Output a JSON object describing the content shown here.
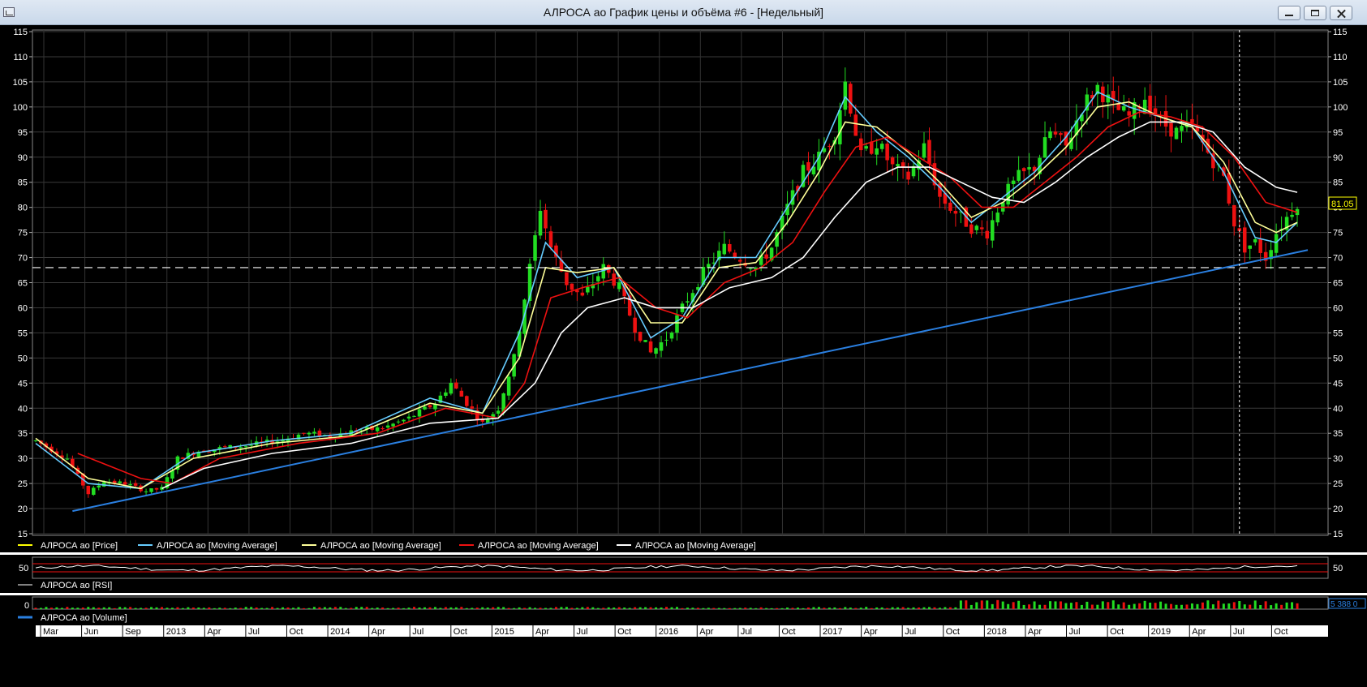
{
  "window": {
    "title": "АЛРОСА ао График цены и объёма #6 - [Недельный]"
  },
  "legend": {
    "price": "АЛРОСА ао [Price]",
    "ma1": "АЛРОСА ао [Moving Average]",
    "ma2": "АЛРОСА ао [Moving Average]",
    "ma3": "АЛРОСА ао [Moving Average]",
    "ma4": "АЛРОСА ао [Moving Average]",
    "rsi": "АЛРОСА ао [RSI]",
    "volume": "АЛРОСА ао [Volume]"
  },
  "colors": {
    "background": "#000000",
    "up_candle": "#22dd22",
    "down_candle": "#ee1111",
    "price": "#ffff00",
    "ma_fast": "#66ccff",
    "ma_mid": "#ffff99",
    "ma_red": "#ee1111",
    "ma_white": "#ffffff",
    "trendline": "#2a7fe0",
    "rsi_line": "#ffffff",
    "volume_bar": "#22dd22"
  },
  "price_labels": {
    "last": "81.05",
    "volume_last": "5 388 0"
  },
  "rsi_panel": {
    "level": "50"
  },
  "volume_panel": {
    "level": "0"
  },
  "chart_data": {
    "type": "candlestick",
    "timeframe": "weekly",
    "ylim": [
      15,
      115
    ],
    "yticks": [
      15,
      20,
      25,
      30,
      35,
      40,
      45,
      50,
      55,
      60,
      65,
      70,
      75,
      80,
      85,
      90,
      95,
      100,
      105,
      110,
      115
    ],
    "time_labels": [
      "Mar",
      "Jun",
      "Sep",
      "2013",
      "Apr",
      "Jul",
      "Oct",
      "2014",
      "Apr",
      "Jul",
      "Oct",
      "2015",
      "Apr",
      "Jul",
      "Oct",
      "2016",
      "Apr",
      "Jul",
      "Oct",
      "2017",
      "Apr",
      "Jul",
      "Oct",
      "2018",
      "Apr",
      "Jul",
      "Oct",
      "2019",
      "Apr",
      "Jul",
      "Oct"
    ],
    "close_series": [
      [
        0,
        33.5
      ],
      [
        6,
        30
      ],
      [
        10,
        23
      ],
      [
        13,
        25.5
      ],
      [
        17,
        25
      ],
      [
        21,
        23.5
      ],
      [
        24,
        24
      ],
      [
        27,
        30
      ],
      [
        31,
        31.5
      ],
      [
        35,
        32
      ],
      [
        40,
        32.5
      ],
      [
        46,
        33.5
      ],
      [
        51,
        35
      ],
      [
        56,
        34.5
      ],
      [
        61,
        35.5
      ],
      [
        66,
        36
      ],
      [
        71,
        38
      ],
      [
        76,
        41
      ],
      [
        79,
        45
      ],
      [
        82,
        41
      ],
      [
        85,
        37
      ],
      [
        88,
        40
      ],
      [
        91,
        50
      ],
      [
        94,
        68
      ],
      [
        96,
        80
      ],
      [
        98,
        72
      ],
      [
        101,
        65
      ],
      [
        104,
        62
      ],
      [
        108,
        68
      ],
      [
        111,
        64
      ],
      [
        114,
        56
      ],
      [
        117,
        51
      ],
      [
        120,
        54
      ],
      [
        123,
        60
      ],
      [
        127,
        67
      ],
      [
        131,
        72
      ],
      [
        134,
        70
      ],
      [
        137,
        68
      ],
      [
        140,
        72
      ],
      [
        143,
        80
      ],
      [
        146,
        87
      ],
      [
        149,
        90
      ],
      [
        152,
        95
      ],
      [
        154,
        105
      ],
      [
        157,
        90
      ],
      [
        160,
        93
      ],
      [
        163,
        88
      ],
      [
        166,
        86
      ],
      [
        169,
        92
      ],
      [
        172,
        82
      ],
      [
        175,
        79
      ],
      [
        178,
        76
      ],
      [
        181,
        75
      ],
      [
        184,
        82
      ],
      [
        187,
        86
      ],
      [
        190,
        88
      ],
      [
        193,
        95
      ],
      [
        196,
        92
      ],
      [
        199,
        100
      ],
      [
        202,
        104
      ],
      [
        205,
        100
      ],
      [
        208,
        98
      ],
      [
        211,
        102
      ],
      [
        214,
        97
      ],
      [
        217,
        95
      ],
      [
        220,
        96
      ],
      [
        223,
        91
      ],
      [
        226,
        86
      ],
      [
        228,
        77
      ],
      [
        230,
        72
      ],
      [
        232,
        73
      ],
      [
        234,
        70
      ],
      [
        236,
        75
      ],
      [
        238,
        78
      ],
      [
        240,
        81.05
      ]
    ],
    "moving_averages": [
      {
        "values": [
          [
            0,
            33
          ],
          [
            10,
            25
          ],
          [
            20,
            24
          ],
          [
            30,
            31
          ],
          [
            45,
            33.5
          ],
          [
            60,
            35
          ],
          [
            75,
            42
          ],
          [
            85,
            39
          ],
          [
            92,
            55
          ],
          [
            97,
            73
          ],
          [
            103,
            66
          ],
          [
            110,
            68
          ],
          [
            117,
            54
          ],
          [
            123,
            58
          ],
          [
            130,
            70
          ],
          [
            137,
            70
          ],
          [
            143,
            80
          ],
          [
            149,
            90
          ],
          [
            154,
            102
          ],
          [
            160,
            95
          ],
          [
            166,
            90
          ],
          [
            172,
            84
          ],
          [
            178,
            77
          ],
          [
            184,
            82
          ],
          [
            190,
            87
          ],
          [
            196,
            94
          ],
          [
            202,
            103
          ],
          [
            208,
            100
          ],
          [
            214,
            98
          ],
          [
            220,
            96
          ],
          [
            226,
            87
          ],
          [
            232,
            74
          ],
          [
            236,
            73
          ],
          [
            240,
            77
          ]
        ]
      },
      {
        "values": [
          [
            0,
            34
          ],
          [
            10,
            26
          ],
          [
            20,
            24
          ],
          [
            30,
            30
          ],
          [
            45,
            33
          ],
          [
            60,
            34.5
          ],
          [
            75,
            41
          ],
          [
            85,
            39
          ],
          [
            92,
            50
          ],
          [
            97,
            68
          ],
          [
            103,
            67
          ],
          [
            110,
            68
          ],
          [
            117,
            57
          ],
          [
            123,
            57
          ],
          [
            130,
            68
          ],
          [
            137,
            69
          ],
          [
            143,
            77
          ],
          [
            149,
            87
          ],
          [
            154,
            97
          ],
          [
            160,
            96
          ],
          [
            166,
            91
          ],
          [
            172,
            85
          ],
          [
            178,
            78
          ],
          [
            184,
            81
          ],
          [
            190,
            86
          ],
          [
            196,
            92
          ],
          [
            202,
            100
          ],
          [
            208,
            101
          ],
          [
            214,
            98
          ],
          [
            220,
            96
          ],
          [
            226,
            89
          ],
          [
            232,
            77
          ],
          [
            236,
            75
          ],
          [
            240,
            77
          ]
        ]
      },
      {
        "values": [
          [
            8,
            31
          ],
          [
            20,
            26
          ],
          [
            26,
            25
          ],
          [
            35,
            30
          ],
          [
            50,
            33
          ],
          [
            65,
            35
          ],
          [
            78,
            40
          ],
          [
            88,
            38
          ],
          [
            93,
            45
          ],
          [
            98,
            62
          ],
          [
            104,
            64
          ],
          [
            111,
            66
          ],
          [
            118,
            60
          ],
          [
            124,
            58
          ],
          [
            131,
            65
          ],
          [
            138,
            68
          ],
          [
            144,
            73
          ],
          [
            150,
            83
          ],
          [
            156,
            92
          ],
          [
            162,
            94
          ],
          [
            168,
            90
          ],
          [
            174,
            86
          ],
          [
            180,
            80
          ],
          [
            186,
            80
          ],
          [
            192,
            85
          ],
          [
            198,
            90
          ],
          [
            204,
            96
          ],
          [
            210,
            99
          ],
          [
            216,
            98
          ],
          [
            222,
            96
          ],
          [
            228,
            90
          ],
          [
            234,
            81
          ],
          [
            240,
            79
          ]
        ]
      },
      {
        "values": [
          [
            24,
            24
          ],
          [
            32,
            28
          ],
          [
            45,
            31
          ],
          [
            60,
            33
          ],
          [
            75,
            37
          ],
          [
            88,
            38
          ],
          [
            95,
            45
          ],
          [
            100,
            55
          ],
          [
            105,
            60
          ],
          [
            112,
            62
          ],
          [
            118,
            60
          ],
          [
            125,
            60
          ],
          [
            132,
            64
          ],
          [
            140,
            66
          ],
          [
            146,
            70
          ],
          [
            152,
            78
          ],
          [
            158,
            85
          ],
          [
            164,
            88
          ],
          [
            170,
            88
          ],
          [
            176,
            85
          ],
          [
            182,
            82
          ],
          [
            188,
            81
          ],
          [
            194,
            85
          ],
          [
            200,
            90
          ],
          [
            206,
            94
          ],
          [
            212,
            97
          ],
          [
            218,
            97
          ],
          [
            224,
            95
          ],
          [
            230,
            88
          ],
          [
            236,
            84
          ],
          [
            240,
            83
          ]
        ]
      }
    ],
    "horizontal_lines": [
      {
        "y": 68,
        "style": "dashed"
      }
    ],
    "trendline": {
      "from": [
        7,
        19.5
      ],
      "to": [
        242,
        71.5
      ]
    },
    "rsi": {
      "ylim": [
        0,
        100
      ],
      "level": 50
    },
    "volume": {
      "ylim": [
        0,
        100
      ]
    }
  }
}
